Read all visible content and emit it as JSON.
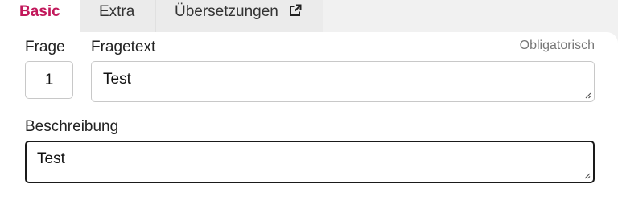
{
  "tabs": [
    {
      "label": "Basic"
    },
    {
      "label": "Extra"
    },
    {
      "label": "Übersetzungen",
      "icon": "external-link-icon"
    }
  ],
  "colors": {
    "active_tab": "#c2185b"
  },
  "form": {
    "frage_label": "Frage",
    "frage_value": "1",
    "fragetext_label": "Fragetext",
    "required_label": "Obligatorisch",
    "fragetext_value": "Test",
    "beschreibung_label": "Beschreibung",
    "beschreibung_value": "Test"
  }
}
